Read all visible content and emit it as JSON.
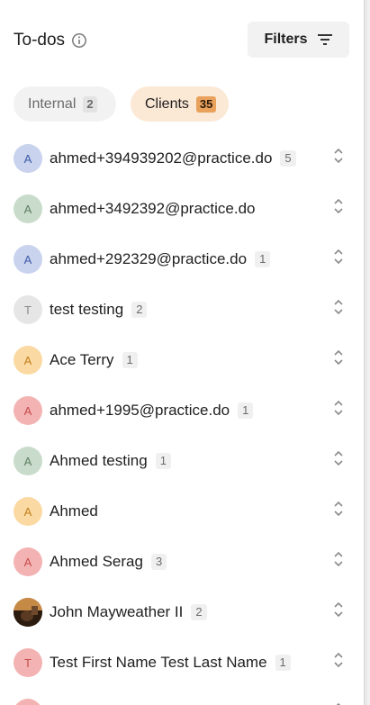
{
  "header": {
    "title": "To-dos",
    "filters_label": "Filters"
  },
  "tabs": [
    {
      "label": "Internal",
      "count": "2"
    },
    {
      "label": "Clients",
      "count": "35"
    }
  ],
  "clients": [
    {
      "initial": "A",
      "name": "ahmed+394939202@practice.do",
      "count": "5",
      "color": "blue"
    },
    {
      "initial": "A",
      "name": "ahmed+3492392@practice.do",
      "count": "",
      "color": "green"
    },
    {
      "initial": "A",
      "name": "ahmed+292329@practice.do",
      "count": "1",
      "color": "blue"
    },
    {
      "initial": "T",
      "name": "test testing",
      "count": "2",
      "color": "grey"
    },
    {
      "initial": "A",
      "name": "Ace Terry",
      "count": "1",
      "color": "yellow"
    },
    {
      "initial": "A",
      "name": "ahmed+1995@practice.do",
      "count": "1",
      "color": "red"
    },
    {
      "initial": "A",
      "name": "Ahmed testing",
      "count": "1",
      "color": "green"
    },
    {
      "initial": "A",
      "name": "Ahmed",
      "count": "",
      "color": "yellow"
    },
    {
      "initial": "A",
      "name": "Ahmed Serag",
      "count": "3",
      "color": "red"
    },
    {
      "initial": "",
      "name": "John Mayweather II",
      "count": "2",
      "color": "photo"
    },
    {
      "initial": "T",
      "name": "Test First Name Test Last Name",
      "count": "1",
      "color": "red"
    }
  ],
  "colors": {
    "clients_tab_bg": "#fbe8d5",
    "clients_count_bg": "#e9a15b",
    "internal_tab_bg": "#f2f2f2"
  }
}
